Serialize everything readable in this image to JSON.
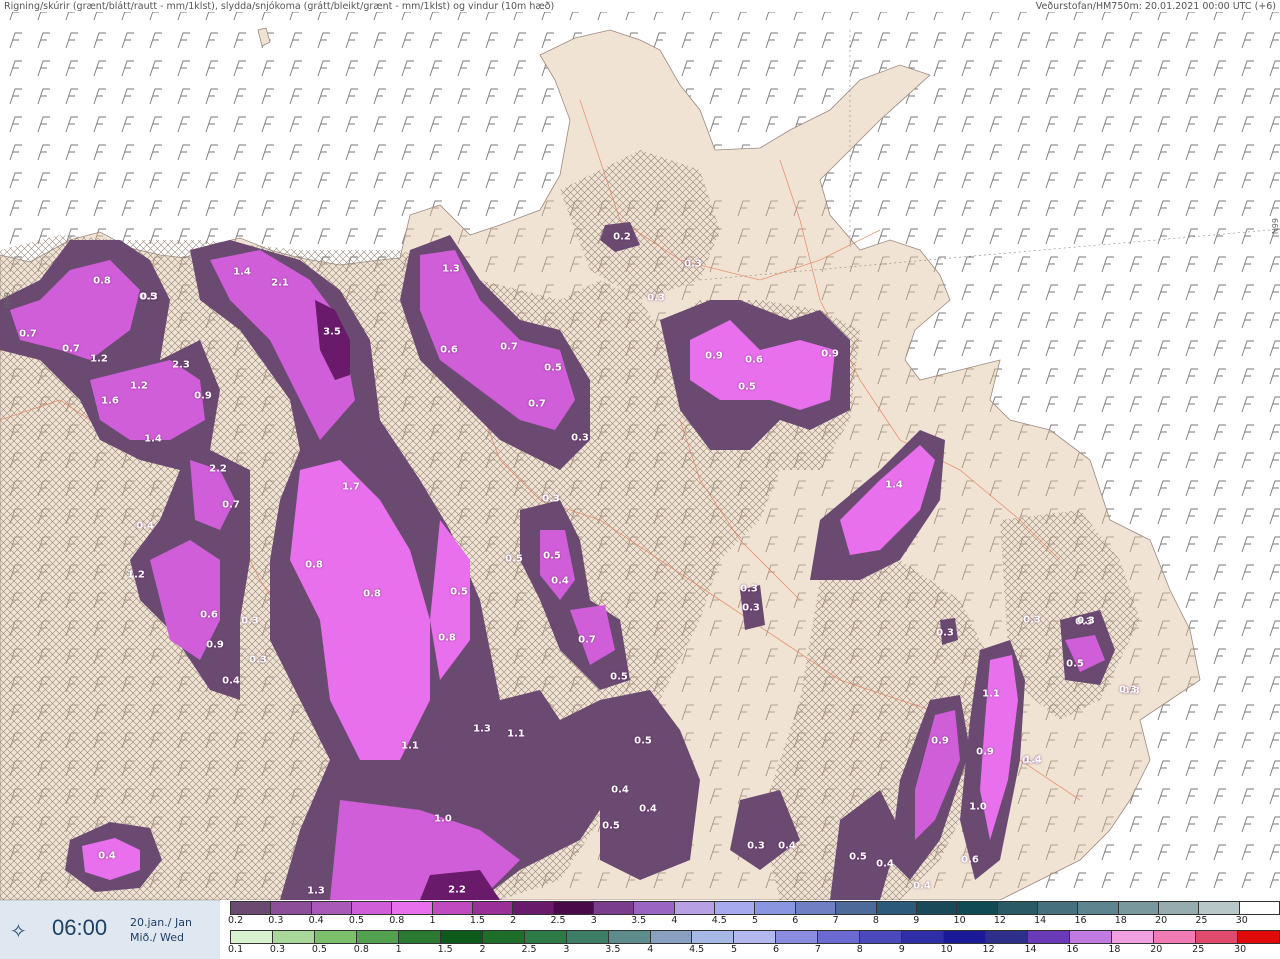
{
  "header": {
    "left": "Rigning/skúrir (grænt/blátt/rautt - mm/1klst), slydda/snjókoma (grátt/bleikt/grænt - mm/1klst) og vindur (10m hæð)",
    "right": "Veðurstofan/HM750m: 20.01.2021 00:00 UTC (+6)"
  },
  "map": {
    "lat_label_right": "66N",
    "lat_label_left": "66N",
    "value_labels": [
      "0.2",
      "0.3",
      "0.3",
      "1.3",
      "0.6",
      "0.7",
      "0.5",
      "0.7",
      "0.3",
      "0.9",
      "0.6",
      "0.5",
      "0.9",
      "1.4",
      "2.1",
      "3.5",
      "1.7",
      "0.8",
      "0.8",
      "0.5",
      "0.7",
      "0.7",
      "1.2",
      "1.2",
      "2.3",
      "0.9",
      "1.6",
      "1.4",
      "2.2",
      "0.7",
      "0.4",
      "1.2",
      "0.8",
      "0.6",
      "0.5",
      "0.8",
      "0.9",
      "0.4",
      "0.3",
      "0.5",
      "0.5",
      "0.4",
      "0.7",
      "0.5",
      "0.5",
      "1.3",
      "1.1",
      "1.1",
      "1.0",
      "0.4",
      "0.4",
      "0.5",
      "0.3",
      "0.4",
      "0.3",
      "0.3",
      "0.3",
      "0.3",
      "0.3",
      "0.5",
      "0.3",
      "1.1",
      "0.9",
      "0.9",
      "1.0",
      "0.4",
      "0.5",
      "0.4",
      "0.4",
      "0.6",
      "1.3",
      "2.2",
      "1.4",
      "0.3",
      "0.3",
      "1.4",
      "0.4",
      "0.3",
      "0.3",
      "0.3"
    ]
  },
  "bottom": {
    "time": "06:00",
    "date_line1": "20.jan./ Jan",
    "date_line2": "Mið./ Wed",
    "time_icon": "sparkle-icon"
  },
  "legend_snow": {
    "ticks": [
      "0.2",
      "0.3",
      "0.4",
      "0.5",
      "0.8",
      "1",
      "1.5",
      "2",
      "2.5",
      "3",
      "3.5",
      "4",
      "4.5",
      "5",
      "6",
      "7",
      "8",
      "9",
      "10",
      "12",
      "14",
      "16",
      "18",
      "20",
      "25",
      "30"
    ],
    "colors": [
      "#6b4a72",
      "#8d4e99",
      "#a95ab8",
      "#d05ed8",
      "#e870ec",
      "#c04bc0",
      "#9a2f9a",
      "#6a1a6a",
      "#4a0a4a",
      "#7a3c8c",
      "#9a64c2",
      "#b8a0e4",
      "#a8aaf0",
      "#8a96e0",
      "#6e7fc4",
      "#4e6a9a",
      "#2c5a7a",
      "#1a4a5a",
      "#104a54",
      "#2a5a66",
      "#46707e",
      "#5e8490",
      "#78989e",
      "#96acae",
      "#b8c8c8",
      "#ffffff"
    ]
  },
  "legend_rain": {
    "ticks": [
      "0.1",
      "0.3",
      "0.5",
      "0.8",
      "1",
      "1.5",
      "2",
      "2.5",
      "3",
      "3.5",
      "4",
      "4.5",
      "5",
      "6",
      "7",
      "8",
      "9",
      "10",
      "12",
      "14",
      "16",
      "18",
      "20",
      "25",
      "30"
    ],
    "colors": [
      "#d8f2d0",
      "#a8d89a",
      "#7cc06c",
      "#52a050",
      "#2c7a32",
      "#0e5a1a",
      "#1f6e2a",
      "#2e7a46",
      "#3f7e66",
      "#5e8c8c",
      "#8aa0c0",
      "#a8b8e4",
      "#b4b8f0",
      "#8a8ce0",
      "#6a6ad0",
      "#4a4abc",
      "#2e2ea8",
      "#1a1a98",
      "#2e2e8c",
      "#6a3ab8",
      "#c07ae0",
      "#f0a0e0",
      "#f07ab4",
      "#e04a6c",
      "#e00a0a"
    ]
  }
}
